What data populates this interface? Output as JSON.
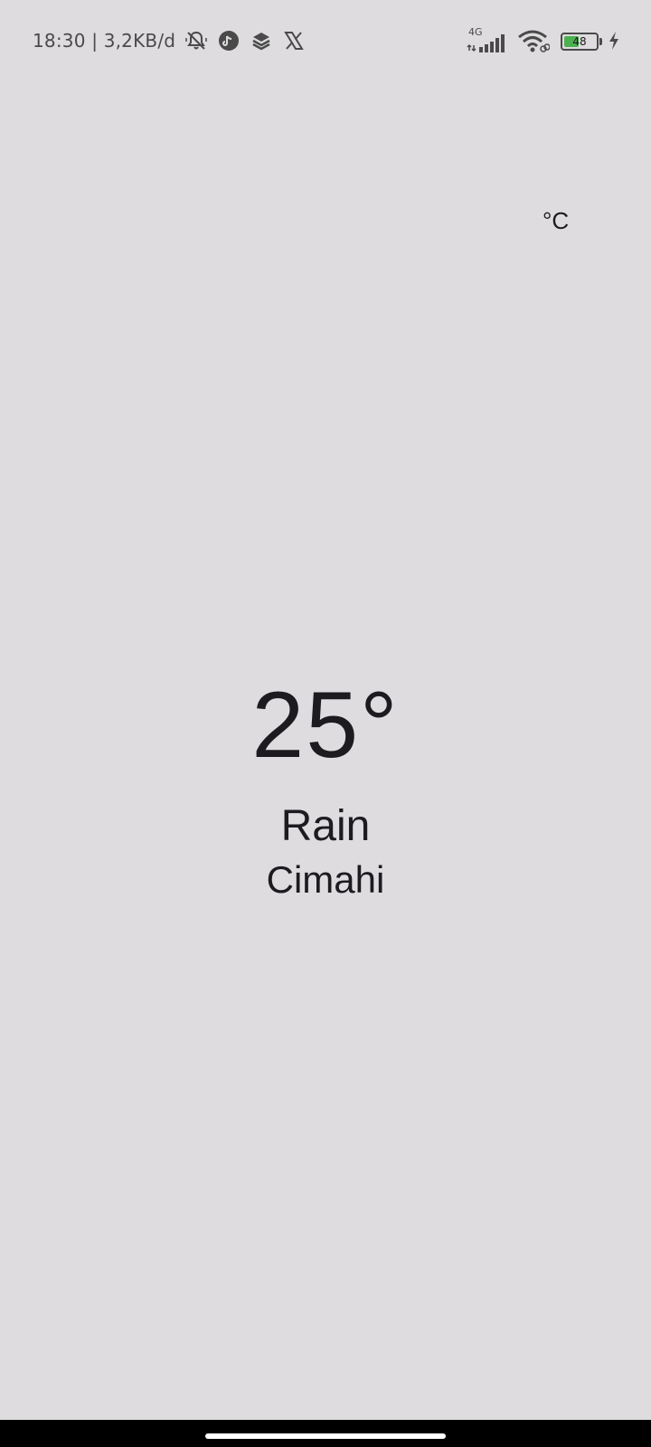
{
  "status_bar": {
    "time_and_speed": "18:30 | 3,2KB/d",
    "icons_left": [
      "bell-off-icon",
      "tiktok-icon",
      "layers-icon",
      "x-logo-icon"
    ],
    "network_type": "4G",
    "signal_bars": 5,
    "battery_level": "48",
    "battery_fraction": 0.48,
    "charging": true,
    "battery_color": "#4caf50"
  },
  "unit_toggle": {
    "label": "°C"
  },
  "weather": {
    "temperature": "25°",
    "condition": "Rain",
    "location": "Cimahi"
  },
  "colors": {
    "background": "#dedcde",
    "text": "#1d1b20",
    "nav_bar": "#000000"
  }
}
